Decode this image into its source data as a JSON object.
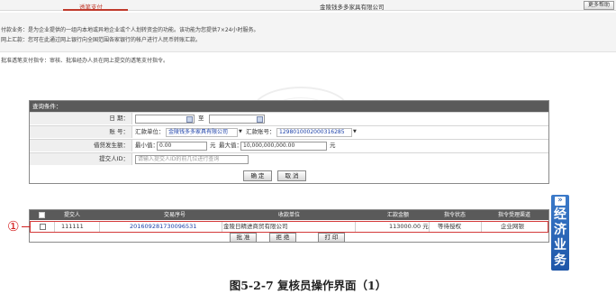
{
  "header": {
    "page_title": "透笔支付",
    "company": "金陵钱多多家具有限公司",
    "help_button": "更多帮助"
  },
  "description": {
    "line1": "付款业务：是为企业提供的一组内本地或异地企业或个人划转资金的功能。该功能为您提供7×24小时服务。",
    "line2": "网上汇款：您可在此通过网上银行向全国范围各家银行的帐户进行人民币转账汇款。"
  },
  "instruction": "批准透笔支付指令：审核、批准经办人员在网上提交的透笔支付指令。",
  "query": {
    "title": "查询条件：",
    "date_label": "日 期：",
    "date_separator": "至",
    "account_label": "账 号：",
    "unit_label": "汇款单位：",
    "unit_value": "金陵钱多多家具有限公司",
    "account_no_label": "汇款账号：",
    "account_no_value": "1298010002000316285",
    "amount_label": "借贷发生额：",
    "min_label": "最小值：",
    "min_value": "0.00",
    "yuan": "元",
    "max_label": "最大值：",
    "max_value": "10,000,000,000.00",
    "submitter_label": "提交人ID：",
    "submitter_placeholder": "请输入提交人ID的前几位进行查询",
    "confirm_button": "确 定",
    "cancel_button": "取 消"
  },
  "results": {
    "columns": [
      "提交人",
      "交易序号",
      "收款单位",
      "汇款金额",
      "指令状态",
      "指令受理渠道"
    ],
    "rows": [
      {
        "submitter": "111111",
        "serial": "201609281730096531",
        "payee": "金陵日精进商贸有限公司",
        "amount": "113000.00 元",
        "status": "等待授权",
        "channel": "企业网银"
      }
    ],
    "approve_button": "批 准",
    "reject_button": "拒 绝",
    "print_button": "打 印"
  },
  "marker": "①",
  "side_tab": {
    "arrow": "»",
    "chars": [
      "经",
      "济",
      "业",
      "务"
    ]
  },
  "caption": "图5-2-7 复核员操作界面（1）",
  "colors": {
    "header_bar": "#5a5a5a",
    "marker_red": "#d42020",
    "side_tab_blue": "#1e56a8",
    "link_blue": "#1a3fa8"
  }
}
